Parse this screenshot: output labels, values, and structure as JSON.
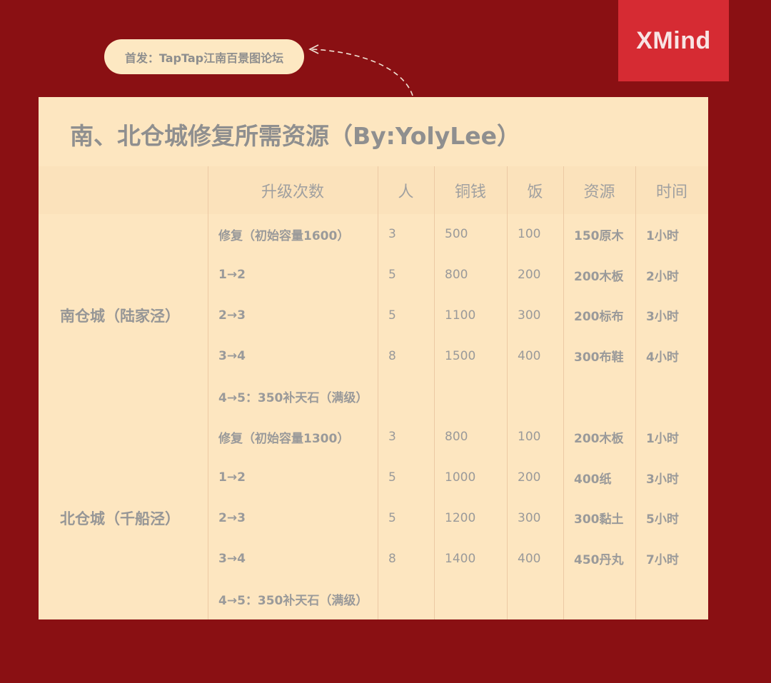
{
  "source_label": "首发：TapTap江南百景图论坛",
  "logo": "XMind",
  "title": "南、北仓城修复所需资源（By:YolyLee）",
  "headers": [
    "升级次数",
    "人",
    "铜钱",
    "饭",
    "资源",
    "时间"
  ],
  "groups": [
    {
      "city": "南仓城（陆家泾）",
      "rows": [
        {
          "level": "修复（初始容量1600）",
          "people": "3",
          "coins": "500",
          "rice": "100",
          "resource": "150原木",
          "time": "1小时"
        },
        {
          "level": "1→2",
          "people": "5",
          "coins": "800",
          "rice": "200",
          "resource": "200木板",
          "time": "2小时"
        },
        {
          "level": "2→3",
          "people": "5",
          "coins": "1100",
          "rice": "300",
          "resource": "200标布",
          "time": "3小时"
        },
        {
          "level": "3→4",
          "people": "8",
          "coins": "1500",
          "rice": "400",
          "resource": "300布鞋",
          "time": "4小时"
        },
        {
          "level": "4→5：350补天石（满级）",
          "people": "",
          "coins": "",
          "rice": "",
          "resource": "",
          "time": ""
        }
      ]
    },
    {
      "city": "北仓城（千船泾）",
      "rows": [
        {
          "level": "修复（初始容量1300）",
          "people": "3",
          "coins": "800",
          "rice": "100",
          "resource": "200木板",
          "time": "1小时"
        },
        {
          "level": "1→2",
          "people": "5",
          "coins": "1000",
          "rice": "200",
          "resource": "400纸",
          "time": "3小时"
        },
        {
          "level": "2→3",
          "people": "5",
          "coins": "1200",
          "rice": "300",
          "resource": "300黏土",
          "time": "5小时"
        },
        {
          "level": "3→4",
          "people": "8",
          "coins": "1400",
          "rice": "400",
          "resource": "450丹丸",
          "time": "7小时"
        },
        {
          "level": "4→5：350补天石（满级）",
          "people": "",
          "coins": "",
          "rice": "",
          "resource": "",
          "time": ""
        }
      ]
    }
  ]
}
